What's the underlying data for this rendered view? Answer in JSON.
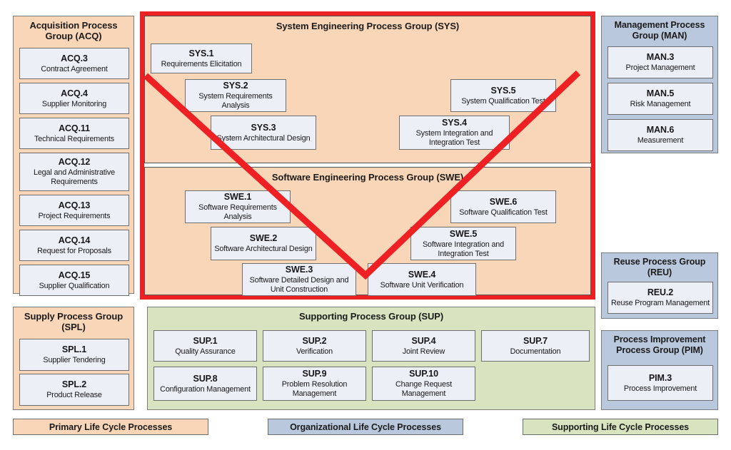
{
  "colors": {
    "primary_life_cycle": "#fad6b8",
    "organizational_life_cycle": "#b9c8dd",
    "supporting_life_cycle": "#d8e4c0",
    "process_box": "#eceff5",
    "v_model_line": "#ed2024",
    "v_frame_border": "#ed2024"
  },
  "acq": {
    "title": "Acquisition Process Group (ACQ)",
    "items": [
      {
        "id": "ACQ.3",
        "name": "Contract Agreement"
      },
      {
        "id": "ACQ.4",
        "name": "Supplier Monitoring"
      },
      {
        "id": "ACQ.11",
        "name": "Technical Requirements"
      },
      {
        "id": "ACQ.12",
        "name": "Legal and Administrative Requirements"
      },
      {
        "id": "ACQ.13",
        "name": "Project Requirements"
      },
      {
        "id": "ACQ.14",
        "name": "Request for Proposals"
      },
      {
        "id": "ACQ.15",
        "name": "Supplier Qualification"
      }
    ]
  },
  "spl": {
    "title": "Supply Process Group (SPL)",
    "items": [
      {
        "id": "SPL.1",
        "name": "Supplier Tendering"
      },
      {
        "id": "SPL.2",
        "name": "Product Release"
      }
    ]
  },
  "sys": {
    "title": "System Engineering Process Group (SYS)",
    "items": [
      {
        "id": "SYS.1",
        "name": "Requirements Elicitation"
      },
      {
        "id": "SYS.2",
        "name": "System Requirements Analysis"
      },
      {
        "id": "SYS.3",
        "name": "System Architectural Design"
      },
      {
        "id": "SYS.4",
        "name": "System Integration and Integration Test"
      },
      {
        "id": "SYS.5",
        "name": "System Qualification Test"
      }
    ]
  },
  "swe": {
    "title": "Software Engineering Process Group (SWE)",
    "items": [
      {
        "id": "SWE.1",
        "name": "Software Requirements Analysis"
      },
      {
        "id": "SWE.2",
        "name": "Software Architectural Design"
      },
      {
        "id": "SWE.3",
        "name": "Software Detailed Design and Unit Construction"
      },
      {
        "id": "SWE.4",
        "name": "Software Unit Verification"
      },
      {
        "id": "SWE.5",
        "name": "Software Integration and Integration Test"
      },
      {
        "id": "SWE.6",
        "name": "Software Qualification Test"
      }
    ]
  },
  "man": {
    "title": "Management Process Group (MAN)",
    "items": [
      {
        "id": "MAN.3",
        "name": "Project Management"
      },
      {
        "id": "MAN.5",
        "name": "Risk Management"
      },
      {
        "id": "MAN.6",
        "name": "Measurement"
      }
    ]
  },
  "reu": {
    "title": "Reuse Process Group (REU)",
    "items": [
      {
        "id": "REU.2",
        "name": "Reuse Program Management"
      }
    ]
  },
  "pim": {
    "title": "Process Improvement Process Group (PIM)",
    "items": [
      {
        "id": "PIM.3",
        "name": "Process Improvement"
      }
    ]
  },
  "sup": {
    "title": "Supporting Process Group (SUP)",
    "items": [
      {
        "id": "SUP.1",
        "name": "Quality Assurance"
      },
      {
        "id": "SUP.2",
        "name": "Verification"
      },
      {
        "id": "SUP.4",
        "name": "Joint Review"
      },
      {
        "id": "SUP.7",
        "name": "Documentation"
      },
      {
        "id": "SUP.8",
        "name": "Configuration Management"
      },
      {
        "id": "SUP.9",
        "name": "Problem Resolution Management"
      },
      {
        "id": "SUP.10",
        "name": "Change Request Management"
      }
    ]
  },
  "legend": {
    "primary": "Primary Life Cycle Processes",
    "organizational": "Organizational Life Cycle Processes",
    "supporting": "Supporting Life Cycle Processes"
  }
}
